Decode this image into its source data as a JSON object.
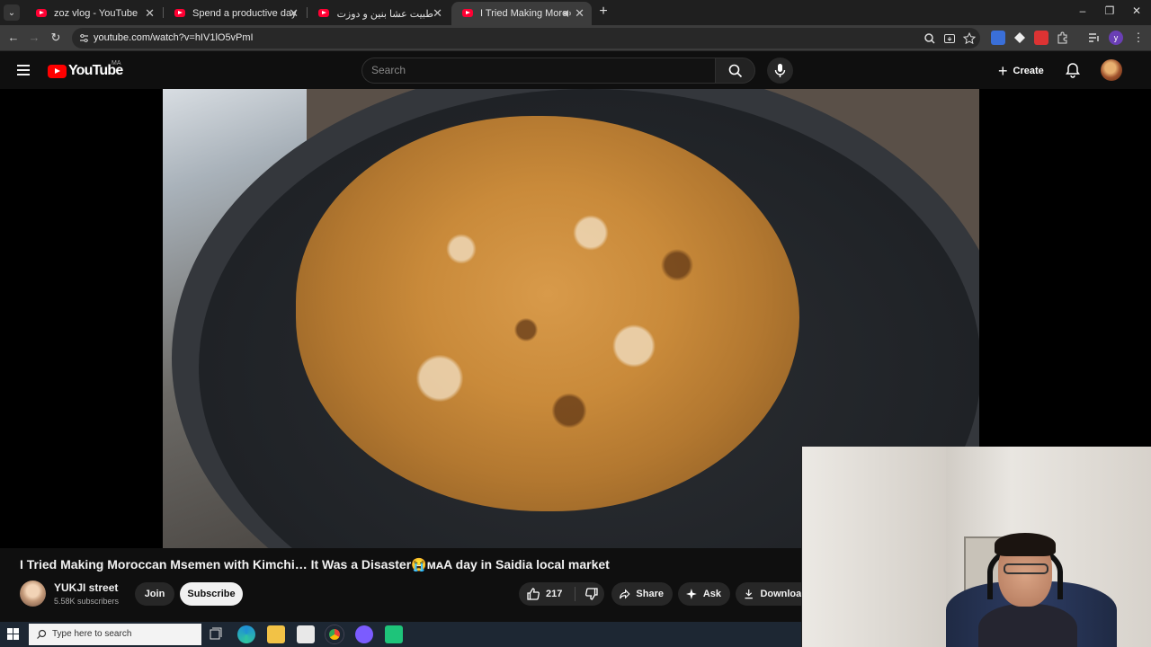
{
  "browser": {
    "tabs": [
      {
        "title": "zoz vlog - YouTube",
        "active": false
      },
      {
        "title": "Spend a productive day with m",
        "active": false
      },
      {
        "title": "طبيت عشا بنين و دوزت نهار واعر",
        "active": false
      },
      {
        "title": "I Tried Making Moroccan M",
        "active": true,
        "audio": true
      }
    ],
    "url": "youtube.com/watch?v=hIV1lO5vPmI"
  },
  "youtube": {
    "logo_text": "YouTube",
    "country_code": "MA",
    "search": {
      "placeholder": "Search",
      "value": ""
    },
    "create_label": "Create"
  },
  "video": {
    "title": "I Tried Making Moroccan Msemen with Kimchi… It Was a Disaster😭ᴍᴀA day in Saidia local market",
    "channel": {
      "name": "YUKJI street",
      "subscribers": "5.58K subscribers"
    },
    "actions": {
      "join": "Join",
      "subscribe": "Subscribe",
      "likes": "217",
      "share": "Share",
      "ask": "Ask",
      "download": "Download"
    }
  },
  "taskbar": {
    "search_placeholder": "Type here to search"
  },
  "colors": {
    "yt_red": "#ff0000",
    "background": "#0f0f0f",
    "pill": "#272727"
  }
}
